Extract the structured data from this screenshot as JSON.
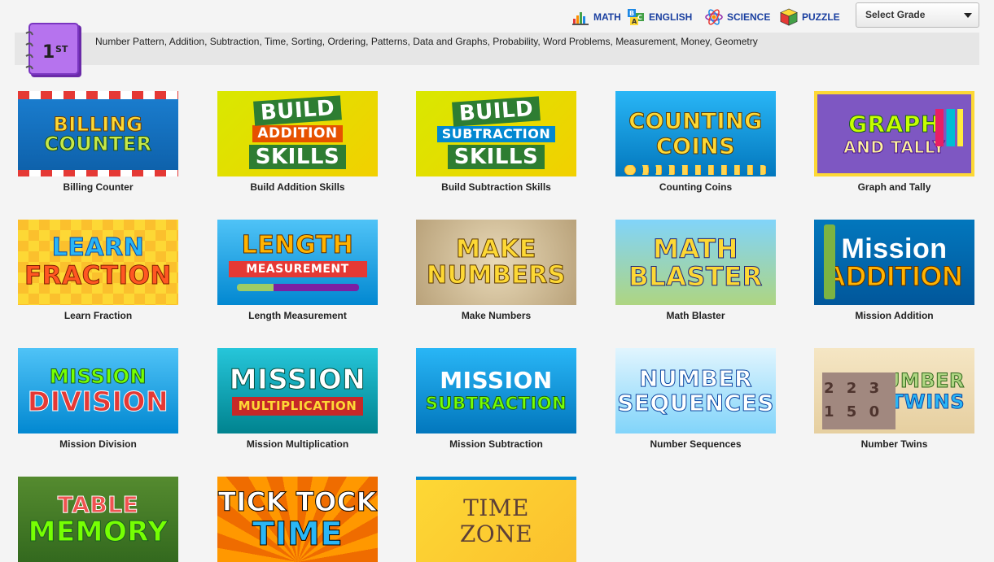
{
  "nav": {
    "items": [
      {
        "label": "MATH",
        "icon": "bar-chart-icon"
      },
      {
        "label": "ENGLISH",
        "icon": "letter-blocks-icon"
      },
      {
        "label": "SCIENCE",
        "icon": "atom-icon"
      },
      {
        "label": "PUZZLE",
        "icon": "rubiks-cube-icon"
      }
    ],
    "grade_select": "Select Grade"
  },
  "grade": {
    "badge": "1",
    "badge_suffix": "ST",
    "topics": "Number Pattern, Addition, Subtraction, Time, Sorting, Ordering, Patterns, Data and Graphs, Probability, Word Problems, Measurement, Money, Geometry"
  },
  "games": [
    {
      "title": "Billing Counter",
      "art": [
        "BILLING",
        "COUNTER",
        ""
      ]
    },
    {
      "title": "Build Addition Skills",
      "art": [
        "BUILD",
        "ADDITION",
        "SKILLS"
      ]
    },
    {
      "title": "Build Subtraction Skills",
      "art": [
        "BUILD",
        "SUBTRACTION",
        "SKILLS"
      ]
    },
    {
      "title": "Counting Coins",
      "art": [
        "COUNTING",
        "COINS",
        ""
      ]
    },
    {
      "title": "Graph and Tally",
      "art": [
        "GRAPH",
        "AND TALLY",
        ""
      ]
    },
    {
      "title": "Learn Fraction",
      "art": [
        "LEARN",
        "FRACTION",
        ""
      ]
    },
    {
      "title": "Length Measurement",
      "art": [
        "LENGTH",
        "MEASUREMENT",
        ""
      ]
    },
    {
      "title": "Make Numbers",
      "art": [
        "MAKE",
        "NUMBERS",
        ""
      ]
    },
    {
      "title": "Math Blaster",
      "art": [
        "MATH",
        "BLASTER",
        ""
      ]
    },
    {
      "title": "Mission Addition",
      "art": [
        "Mission",
        "ADDITION",
        ""
      ]
    },
    {
      "title": "Mission Division",
      "art": [
        "MISSION",
        "DIVISION",
        ""
      ]
    },
    {
      "title": "Mission Multiplication",
      "art": [
        "MISSION",
        "MULTIPLICATION",
        ""
      ]
    },
    {
      "title": "Mission Subtraction",
      "art": [
        "MISSION",
        "SUBTRACTION",
        ""
      ]
    },
    {
      "title": "Number Sequences",
      "art": [
        "NUMBER",
        "SEQUENCES",
        ""
      ]
    },
    {
      "title": "Number Twins",
      "art": [
        "NUMBER",
        "TWINS",
        "2 2 3 1 5 0"
      ]
    },
    {
      "title": "",
      "art": [
        "TABLE",
        "MEMORY",
        ""
      ]
    },
    {
      "title": "",
      "art": [
        "TICK TOCK",
        "TIME",
        ""
      ]
    },
    {
      "title": "",
      "art": [
        "TIME",
        "ZONE",
        ""
      ]
    }
  ],
  "colors": {
    "link": "#1a3fa0",
    "badge_purple": "#9a4ed8",
    "background": "#f4f4f4"
  }
}
